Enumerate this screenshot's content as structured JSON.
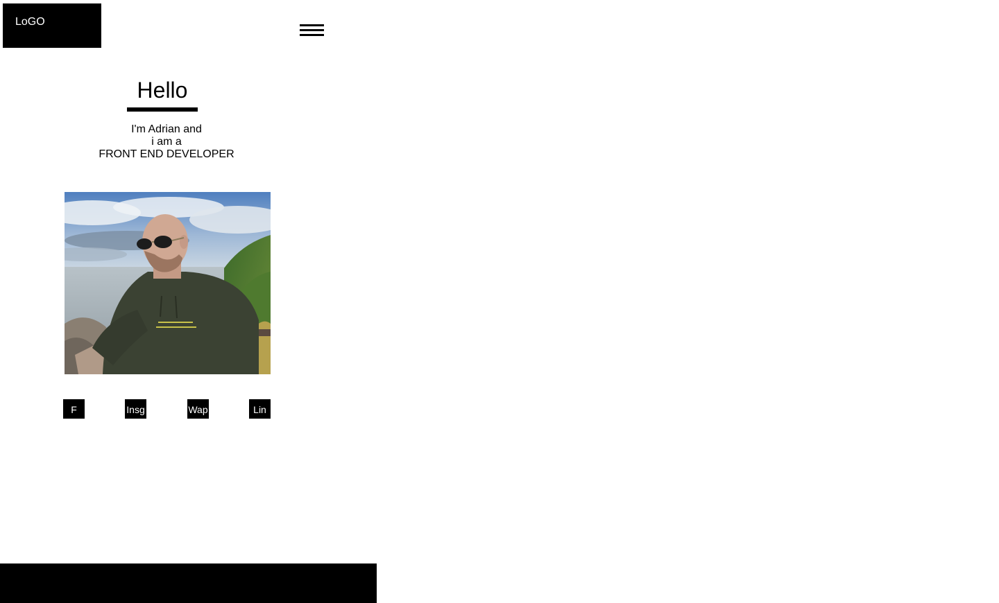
{
  "header": {
    "logo_text": "LoGO",
    "menu_icon": "hamburger-menu-icon"
  },
  "hero": {
    "title": "Hello",
    "intro_lines": [
      "I'm Adrian and",
      "i am a",
      "FRONT END DEVELOPER"
    ]
  },
  "social_links": [
    {
      "label": "F"
    },
    {
      "label": "Insg"
    },
    {
      "label": "Wap"
    },
    {
      "label": "Lin"
    }
  ],
  "colors": {
    "background": "#ffffff",
    "primary": "#000000",
    "text_on_primary": "#ffffff"
  }
}
